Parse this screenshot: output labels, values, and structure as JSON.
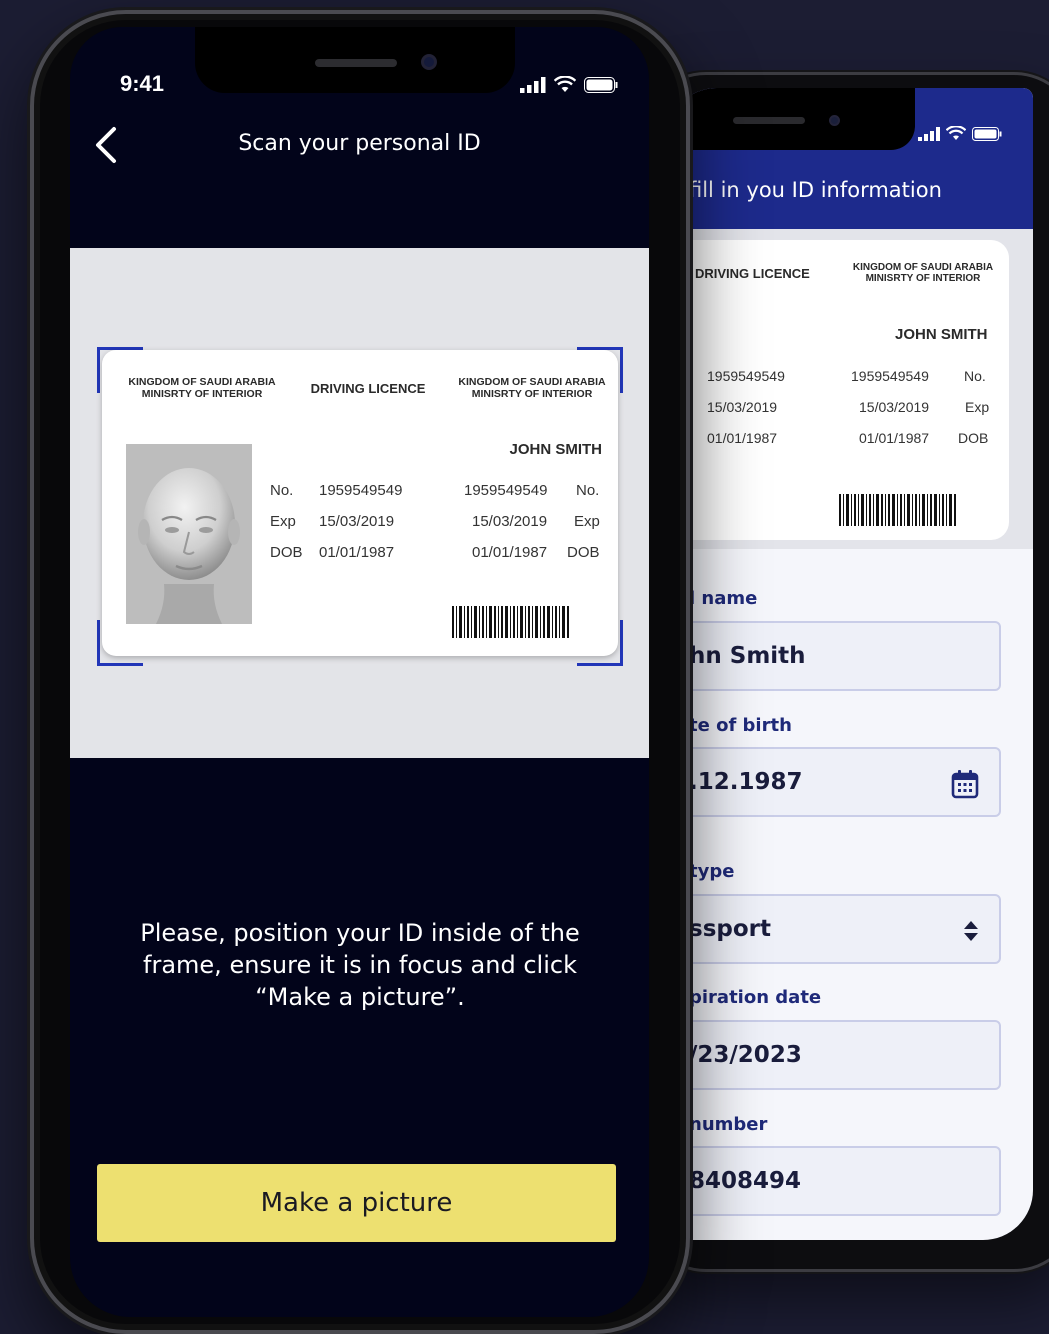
{
  "back_screen": {
    "title": "fill in you ID information",
    "card": {
      "licence_label": "DRIVING LICENCE",
      "authority_line1": "KINGDOM OF SAUDI ARABIA",
      "authority_line2": "MINISRTY OF INTERIOR",
      "name": "JOHN SMITH",
      "left_values": [
        "1959549549",
        "15/03/2019",
        "01/01/1987"
      ],
      "right_values": [
        "1959549549",
        "15/03/2019",
        "01/01/1987"
      ],
      "right_labels": [
        "No.",
        "Exp",
        "DOB"
      ]
    },
    "form": {
      "full_name_label": "l name",
      "full_name_value": "hn Smith",
      "dob_label": "te of birth",
      "dob_value": ".12.1987",
      "doc_type_label": "type",
      "doc_type_value": "ssport",
      "expiration_label": "piration date",
      "expiration_value": "/23/2023",
      "number_label": "number",
      "number_value": "8408494"
    },
    "icons": [
      "calendar-icon",
      "select-arrows-icon",
      "signal-icon",
      "wifi-icon",
      "battery-icon"
    ],
    "colors": {
      "header": "#1d2a8c",
      "label": "#1f2a7a",
      "field_bg": "#eef0f8"
    }
  },
  "front_screen": {
    "time": "9:41",
    "title": "Scan your personal ID",
    "card": {
      "authority_line1": "KINGDOM OF SAUDI ARABIA",
      "authority_line2": "MINISRTY OF INTERIOR",
      "licence_label": "DRIVING LICENCE",
      "name": "JOHN SMITH",
      "labels": [
        "No.",
        "Exp",
        "DOB"
      ],
      "values": [
        "1959549549",
        "15/03/2019",
        "01/01/1987"
      ]
    },
    "instruction": "Please, position your ID inside of the frame, ensure it is in focus and click “Make a picture”.",
    "button_label": "Make a picture",
    "icons": [
      "back-arrow-icon",
      "signal-icon",
      "wifi-icon",
      "battery-icon",
      "face-photo"
    ],
    "colors": {
      "background": "#02041a",
      "button": "#ede070",
      "scan_frame": "#2236b8"
    }
  }
}
